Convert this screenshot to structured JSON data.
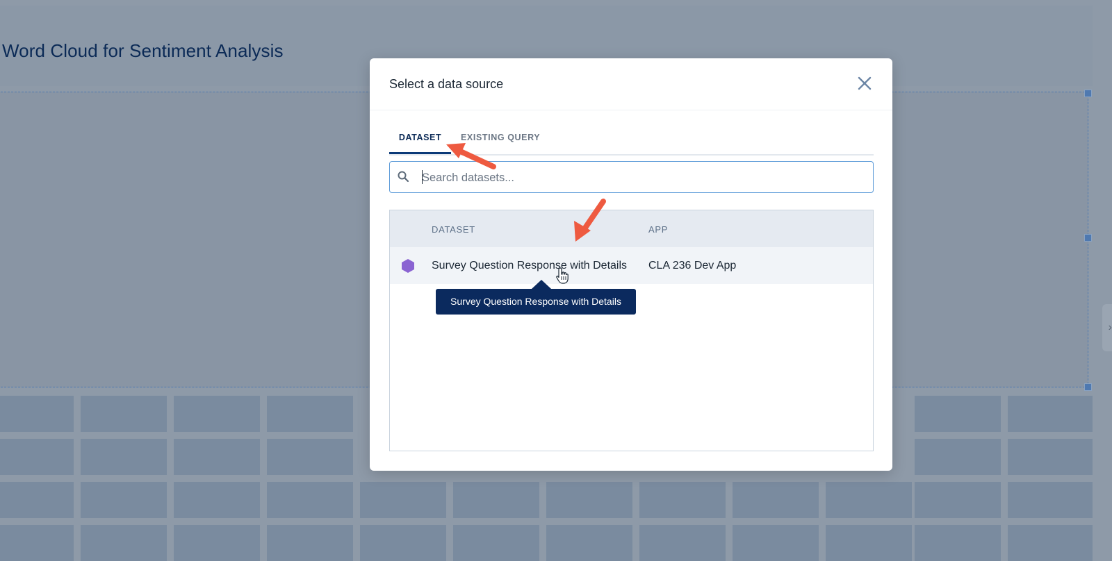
{
  "page": {
    "title": "Word Cloud for Sentiment Analysis"
  },
  "modal": {
    "title": "Select a data source",
    "close_icon": "close-icon",
    "tabs": [
      {
        "label": "DATASET",
        "active": true
      },
      {
        "label": "EXISTING QUERY",
        "active": false
      }
    ],
    "search": {
      "placeholder": "Search datasets...",
      "value": "",
      "icon": "search-icon"
    },
    "table": {
      "columns": [
        "DATASET",
        "APP"
      ],
      "rows": [
        {
          "dataset": "Survey Question Response with Details",
          "app": "CLA 236 Dev App",
          "icon": "dataset-hexagon-icon"
        }
      ]
    },
    "tooltip": "Survey Question Response with Details"
  },
  "colors": {
    "accent": "#0b3a78",
    "annotation_arrow": "#ee5a40",
    "dataset_icon": "#8a63d2",
    "tooltip_bg": "#0b2a5e"
  }
}
